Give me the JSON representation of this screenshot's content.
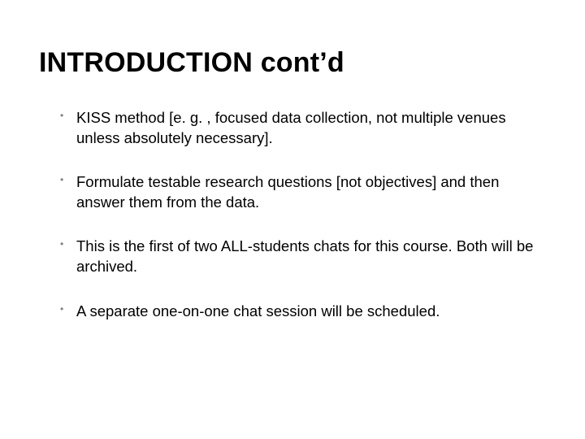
{
  "title": "INTRODUCTION cont’d",
  "bullets": [
    "KISS method [e. g. , focused data collection, not multiple venues unless absolutely necessary].",
    "Formulate testable research questions [not objectives] and then answer them from the data.",
    "This is the first of two ALL-students chats for this course. Both will be archived.",
    "A separate one-on-one chat session will be scheduled."
  ]
}
